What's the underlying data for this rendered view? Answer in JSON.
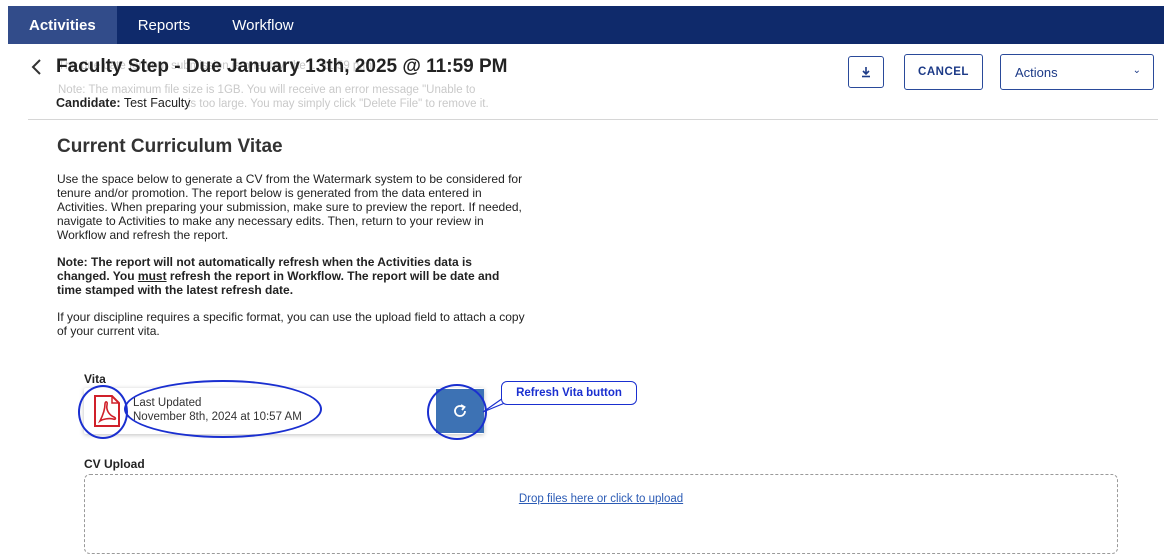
{
  "nav": {
    "tabs": [
      {
        "label": "Activities",
        "active": true
      },
      {
        "label": "Reports",
        "active": false
      },
      {
        "label": "Workflow",
        "active": false
      }
    ]
  },
  "header": {
    "ghost_line1": "The due date for your submission is one day, the ... 11:59 p.m.",
    "ghost_line2": "Note: The maximum file size is 1GB. You will receive an error message \"Unable to",
    "ghost_line3": "... is too large. You may simply click \"Delete File\" to remove it.",
    "title": "Faculty Step - Due January 13th, 2025 @ 11:59 PM",
    "candidate_label": "Candidate:",
    "candidate_value": "Test Faculty",
    "cancel_label": "CANCEL",
    "actions_label": "Actions"
  },
  "content": {
    "heading": "Current Curriculum Vitae",
    "para1": "Use the space below to generate a CV from the Watermark system to be considered for tenure and/or promotion. The report below is generated from the data entered in Activities. When preparing your submission, make sure to preview the report. If needed, navigate to Activities to make any necessary edits. Then, return to your review in Workflow and refresh the report.",
    "note_pre": "Note: The report will not automatically refresh when the Activities data is changed. You ",
    "note_must": "must",
    "note_post": " refresh the report in Workflow. The report will be date and time stamped with the latest refresh date.",
    "para3": "If your discipline requires a specific format, you can use the upload field to attach a copy of your current vita."
  },
  "vita": {
    "label": "Vita",
    "last_updated_label": "Last Updated",
    "last_updated_value": "November 8th, 2024 at 10:57 AM",
    "callout": "Refresh Vita button"
  },
  "upload": {
    "label": "CV Upload",
    "dropzone_text": "Drop files here or click to upload"
  },
  "colors": {
    "nav_bg": "#0f2a6b",
    "nav_active": "#324c8a",
    "accent": "#1c3a87",
    "refresh_button": "#3d72b4",
    "annotation": "#1a2fd0",
    "pdf_red": "#d0202a"
  }
}
